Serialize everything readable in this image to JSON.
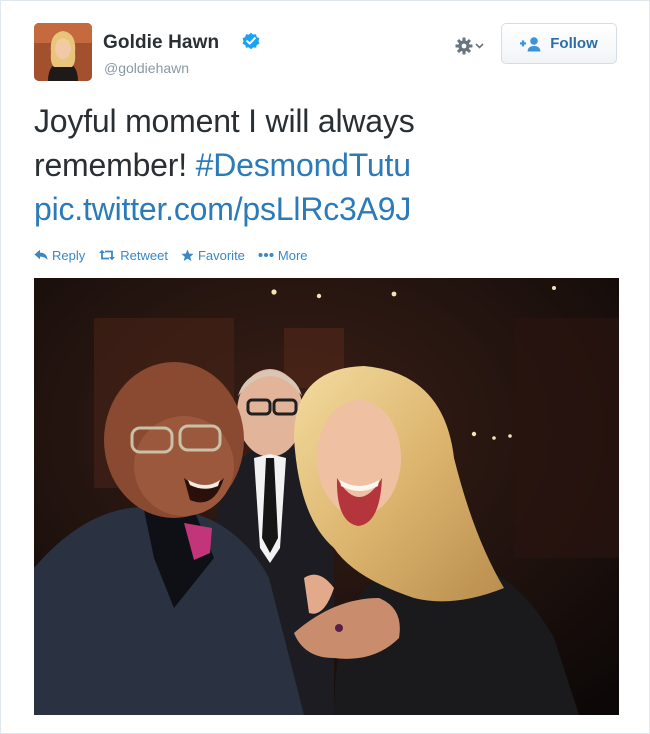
{
  "user": {
    "name": "Goldie Hawn",
    "screen_name": "@goldiehawn",
    "verified": true
  },
  "header": {
    "follow_label": "Follow"
  },
  "tweet": {
    "text_line1": "Joyful moment I will always",
    "text_line2_plain": "remember! ",
    "hashtag": "#DesmondTutu",
    "link": "pic.twitter.com/psLlRc3A9J"
  },
  "actions": {
    "reply": "Reply",
    "retweet": "Retweet",
    "favorite": "Favorite",
    "more": "More"
  },
  "colors": {
    "link": "#2b7bb9",
    "verified": "#1da1f2",
    "action": "#3a87c5",
    "muted": "#8899a6"
  }
}
